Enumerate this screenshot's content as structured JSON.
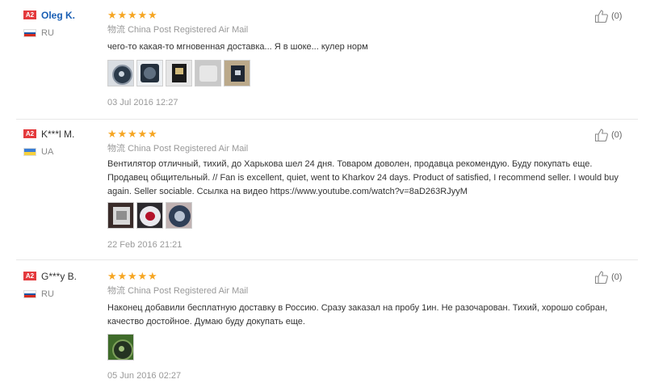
{
  "reviews": [
    {
      "badge": "A2",
      "name": "Oleg K.",
      "name_is_link": true,
      "country": "RU",
      "rating": 5,
      "shipping_label": "物流",
      "shipping_method": "China Post Registered Air Mail",
      "text": "чего-то какая-то мгновенная доставка... Я в шоке... кулер норм",
      "photo_icons": [
        "fan-photo-icon",
        "fan-photo-icon",
        "package-photo-icon",
        "package-photo-icon",
        "box-photo-icon"
      ],
      "date": "03 Jul 2016 12:27",
      "useful_count": "(0)"
    },
    {
      "badge": "A2",
      "name": "K***l M.",
      "name_is_link": false,
      "country": "UA",
      "rating": 5,
      "shipping_label": "物流",
      "shipping_method": "China Post Registered Air Mail",
      "text": "Вентилятор отличный, тихий, до Харькова шел 24 дня. Товаром доволен, продавца рекомендую. Буду покупать еще. Продавец общительный. // Fan is excellent, quiet, went to Kharkov 24 days. Product of satisfied, I recommend seller. I would buy again. Seller sociable. Ссылка на видео https://www.youtube.com/watch?v=8aD263RJyyM",
      "photo_icons": [
        "package-photo-icon",
        "fan-photo-icon",
        "fan-photo-icon"
      ],
      "date": "22 Feb 2016 21:21",
      "useful_count": "(0)"
    },
    {
      "badge": "A2",
      "name": "G***y B.",
      "name_is_link": false,
      "country": "RU",
      "rating": 5,
      "shipping_label": "物流",
      "shipping_method": "China Post Registered Air Mail",
      "text": "Наконец добавили бесплатную доставку в Россию. Сразу заказал на пробу 1ин. Не разочарован. Тихий, хорошо собран, качество достойное. Думаю буду докупать еще.",
      "photo_icons": [
        "installed-fan-photo-icon"
      ],
      "date": "05 Jun 2016 02:27",
      "useful_count": "(0)"
    }
  ],
  "colors": {
    "star": "#f6a623",
    "badge": "#e43a3d",
    "link": "#1a5fb4",
    "flag_ru": [
      "#ffffff",
      "#1c57a7",
      "#d52b1e"
    ],
    "flag_ua": [
      "#3c7fd6",
      "#f7d13d"
    ]
  }
}
